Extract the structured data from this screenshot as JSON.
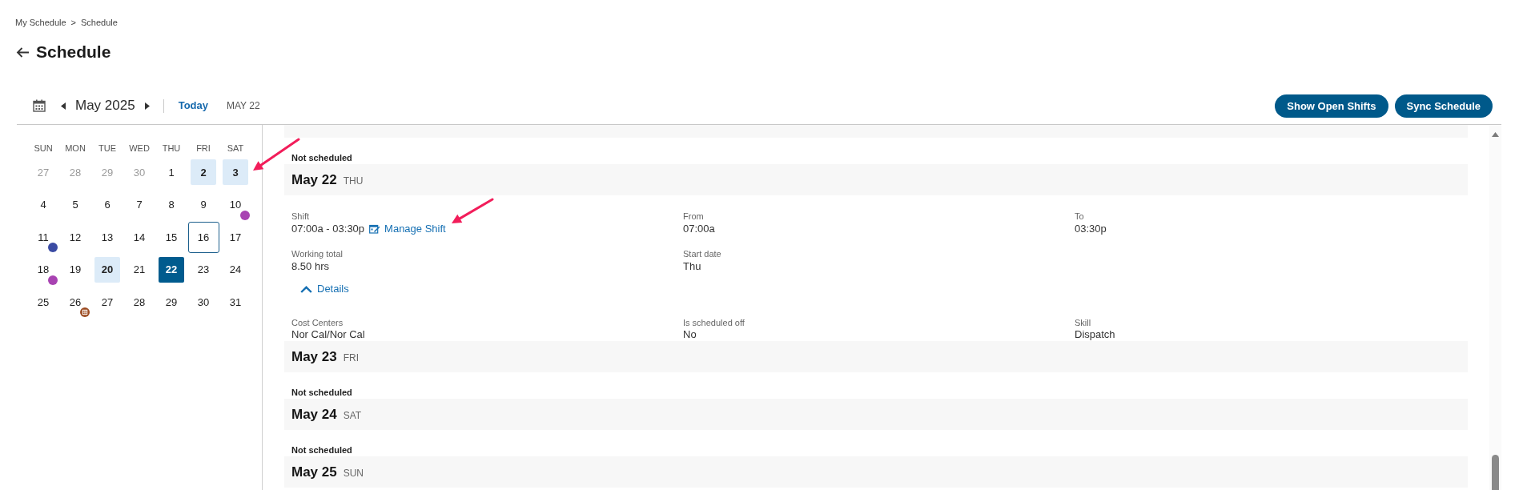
{
  "breadcrumb": {
    "items": [
      "My Schedule",
      "Schedule"
    ],
    "separator": ">"
  },
  "page_title": "Schedule",
  "toolbar": {
    "month": "May 2025",
    "today_button": "Today",
    "selected_date": "MAY 22",
    "buttons": [
      {
        "label": "Show Open Shifts"
      },
      {
        "label": "Sync Schedule"
      }
    ]
  },
  "calendar": {
    "weekdays": [
      "SUN",
      "MON",
      "TUE",
      "WED",
      "THU",
      "FRI",
      "SAT"
    ],
    "weeks": [
      [
        {
          "day": "27",
          "outside": true,
          "highlighted": false,
          "today": false,
          "selected": false
        },
        {
          "day": "28",
          "outside": true,
          "highlighted": false,
          "today": false,
          "selected": false
        },
        {
          "day": "29",
          "outside": true,
          "highlighted": false,
          "today": false,
          "selected": false
        },
        {
          "day": "30",
          "outside": true,
          "highlighted": false,
          "today": false,
          "selected": false
        },
        {
          "day": "1",
          "outside": false,
          "highlighted": false,
          "today": false,
          "selected": false
        },
        {
          "day": "2",
          "outside": false,
          "highlighted": true,
          "today": false,
          "selected": false
        },
        {
          "day": "3",
          "outside": false,
          "highlighted": true,
          "today": false,
          "selected": false
        }
      ],
      [
        {
          "day": "4",
          "outside": false,
          "highlighted": false,
          "today": false,
          "selected": false
        },
        {
          "day": "5",
          "outside": false,
          "highlighted": false,
          "today": false,
          "selected": false
        },
        {
          "day": "6",
          "outside": false,
          "highlighted": false,
          "today": false,
          "selected": false
        },
        {
          "day": "7",
          "outside": false,
          "highlighted": false,
          "today": false,
          "selected": false
        },
        {
          "day": "8",
          "outside": false,
          "highlighted": false,
          "today": false,
          "selected": false
        },
        {
          "day": "9",
          "outside": false,
          "highlighted": false,
          "today": false,
          "selected": false
        },
        {
          "day": "10",
          "outside": false,
          "highlighted": false,
          "today": false,
          "selected": false,
          "marker": {
            "kind": "dot",
            "color": "#a843b2"
          }
        }
      ],
      [
        {
          "day": "11",
          "outside": false,
          "highlighted": false,
          "today": false,
          "selected": false,
          "marker": {
            "kind": "dot",
            "color": "#3a4ba3"
          }
        },
        {
          "day": "12",
          "outside": false,
          "highlighted": false,
          "today": false,
          "selected": false
        },
        {
          "day": "13",
          "outside": false,
          "highlighted": false,
          "today": false,
          "selected": false
        },
        {
          "day": "14",
          "outside": false,
          "highlighted": false,
          "today": false,
          "selected": false
        },
        {
          "day": "15",
          "outside": false,
          "highlighted": false,
          "today": false,
          "selected": false
        },
        {
          "day": "16",
          "outside": false,
          "highlighted": false,
          "today": true,
          "selected": false
        },
        {
          "day": "17",
          "outside": false,
          "highlighted": false,
          "today": false,
          "selected": false
        }
      ],
      [
        {
          "day": "18",
          "outside": false,
          "highlighted": false,
          "today": false,
          "selected": false,
          "marker": {
            "kind": "dot",
            "color": "#a843b2"
          }
        },
        {
          "day": "19",
          "outside": false,
          "highlighted": false,
          "today": false,
          "selected": false
        },
        {
          "day": "20",
          "outside": false,
          "highlighted": true,
          "today": false,
          "selected": false
        },
        {
          "day": "21",
          "outside": false,
          "highlighted": false,
          "today": false,
          "selected": false
        },
        {
          "day": "22",
          "outside": false,
          "highlighted": false,
          "today": false,
          "selected": true
        },
        {
          "day": "23",
          "outside": false,
          "highlighted": false,
          "today": false,
          "selected": false
        },
        {
          "day": "24",
          "outside": false,
          "highlighted": false,
          "today": false,
          "selected": false
        }
      ],
      [
        {
          "day": "25",
          "outside": false,
          "highlighted": false,
          "today": false,
          "selected": false
        },
        {
          "day": "26",
          "outside": false,
          "highlighted": false,
          "today": false,
          "selected": false,
          "marker": {
            "kind": "badge",
            "color": "#9b4a20"
          }
        },
        {
          "day": "27",
          "outside": false,
          "highlighted": false,
          "today": false,
          "selected": false
        },
        {
          "day": "28",
          "outside": false,
          "highlighted": false,
          "today": false,
          "selected": false
        },
        {
          "day": "29",
          "outside": false,
          "highlighted": false,
          "today": false,
          "selected": false
        },
        {
          "day": "30",
          "outside": false,
          "highlighted": false,
          "today": false,
          "selected": false
        },
        {
          "day": "31",
          "outside": false,
          "highlighted": false,
          "today": false,
          "selected": false
        }
      ]
    ]
  },
  "schedule_days": [
    {
      "kind": "not_scheduled",
      "status": "Not scheduled"
    },
    {
      "date": "May 22",
      "weekday": "THU",
      "kind": "shift",
      "fields": [
        {
          "label": "Shift",
          "value": "07:00a - 03:30p",
          "link": "Manage Shift"
        },
        {
          "label": "From",
          "value": "07:00a"
        },
        {
          "label": "To",
          "value": "03:30p"
        },
        {
          "label": "Working total",
          "value": "8.50 hrs"
        },
        {
          "label": "Start date",
          "value": "Thu"
        }
      ],
      "details": {
        "label": "Details",
        "expanded": true,
        "fields": [
          {
            "label": "Cost Centers",
            "value": "Nor Cal/Nor Cal"
          },
          {
            "label": "Is scheduled off",
            "value": "No"
          },
          {
            "label": "Skill",
            "value": "Dispatch"
          }
        ]
      }
    },
    {
      "date": "May 23",
      "weekday": "FRI",
      "kind": "not_scheduled",
      "status": "Not scheduled"
    },
    {
      "date": "May 24",
      "weekday": "SAT",
      "kind": "not_scheduled",
      "status": "Not scheduled"
    },
    {
      "date": "May 25",
      "weekday": "SUN",
      "kind": "header_only"
    }
  ]
}
